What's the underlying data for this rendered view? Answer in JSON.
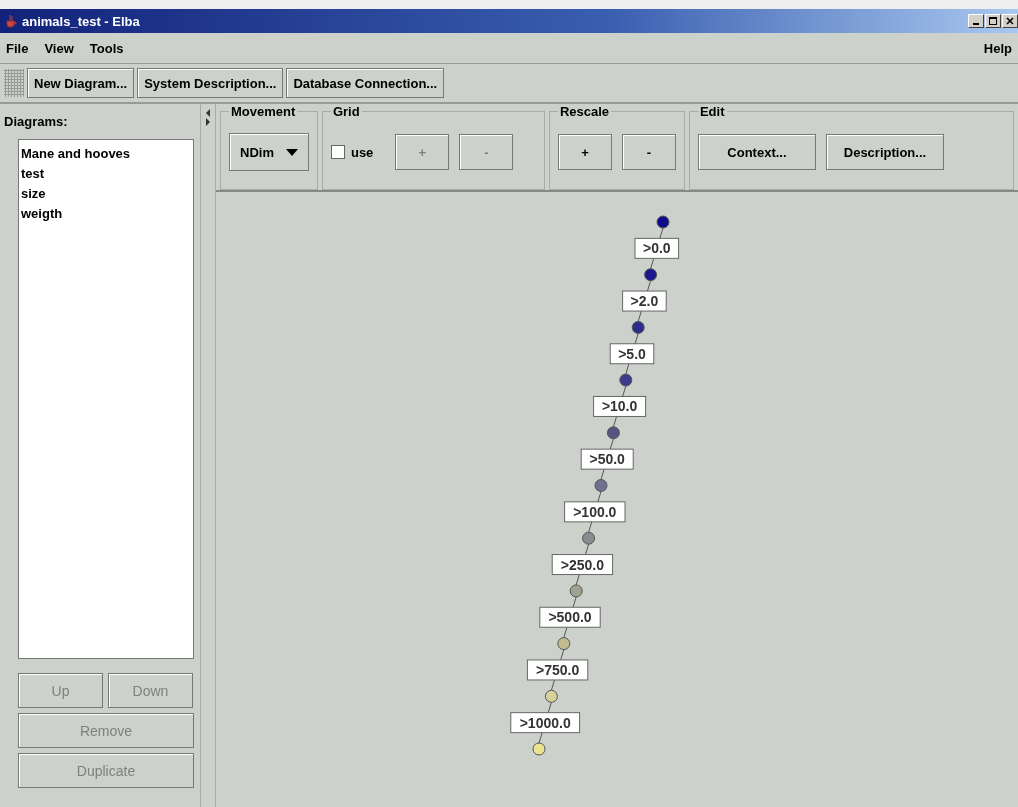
{
  "window": {
    "title": "animals_test - Elba"
  },
  "menu": {
    "left": [
      "File",
      "View",
      "Tools"
    ],
    "right": "Help"
  },
  "toolbar": [
    "New Diagram...",
    "System Description...",
    "Database Connection..."
  ],
  "sidebar": {
    "title": "Diagrams:",
    "items": [
      {
        "label": "Mane and hooves",
        "selected": false
      },
      {
        "label": "test",
        "selected": false
      },
      {
        "label": "size",
        "selected": false
      },
      {
        "label": "weigth",
        "selected": false
      }
    ],
    "buttons": [
      {
        "label": "Up",
        "disabled": true
      },
      {
        "label": "Down",
        "disabled": true
      },
      {
        "label": "Remove",
        "disabled": true
      },
      {
        "label": "Duplicate",
        "disabled": true
      }
    ]
  },
  "movement": {
    "title": "Movement",
    "value": "NDim"
  },
  "grid": {
    "title": "Grid",
    "checkbox": {
      "label": "use",
      "checked": false
    },
    "buttons": [
      {
        "label": "+",
        "disabled": true
      },
      {
        "label": "-",
        "disabled": true
      }
    ]
  },
  "rescale": {
    "title": "Rescale",
    "buttons": [
      {
        "label": "+",
        "disabled": false
      },
      {
        "label": "-",
        "disabled": false
      }
    ]
  },
  "edit": {
    "title": "Edit",
    "buttons": [
      "Context...",
      "Description..."
    ]
  },
  "diagram": {
    "nodes": [
      {
        "color": "#0c0c8c"
      },
      {
        "color": "#1a1a8e"
      },
      {
        "color": "#2c2c8e"
      },
      {
        "color": "#3c3c8a"
      },
      {
        "color": "#555584"
      },
      {
        "color": "#707090"
      },
      {
        "color": "#8a8a90"
      },
      {
        "color": "#a2a292"
      },
      {
        "color": "#c2ba90"
      },
      {
        "color": "#d8d29a"
      },
      {
        "color": "#ece48e"
      }
    ],
    "labels": [
      ">0.0",
      ">2.0",
      ">5.0",
      ">10.0",
      ">50.0",
      ">100.0",
      ">250.0",
      ">500.0",
      ">750.0",
      ">1000.0"
    ]
  }
}
